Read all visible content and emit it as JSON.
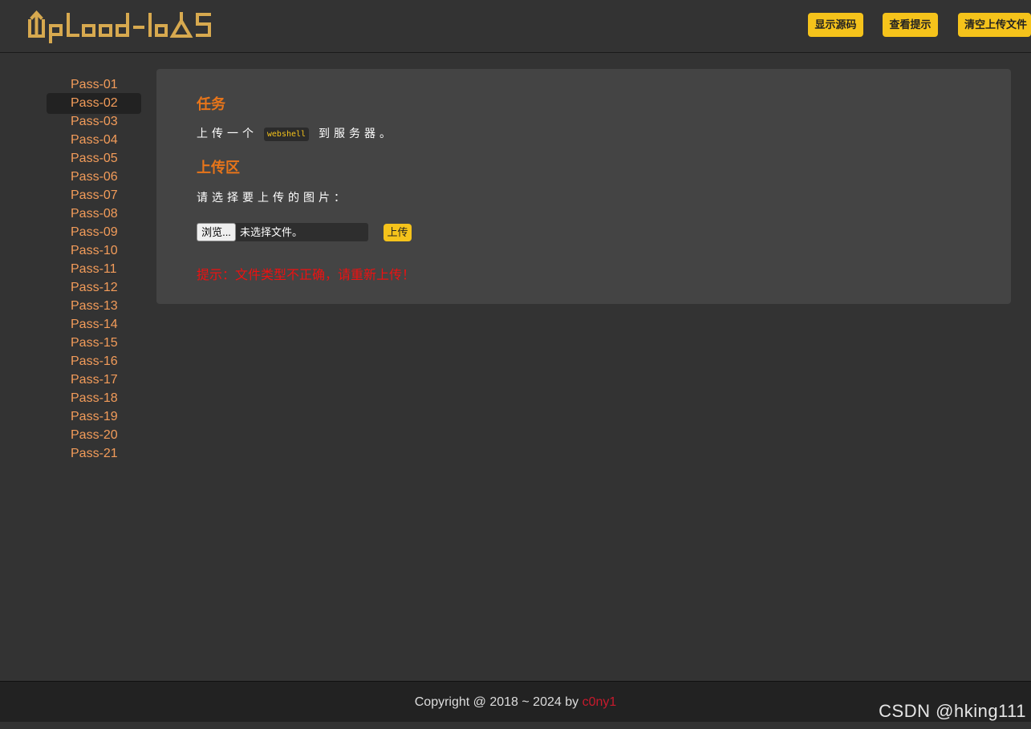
{
  "header": {
    "logo_text": "UpLoad-labS",
    "logo_color": "#d7a94f",
    "buttons": {
      "show_source": "显示源码",
      "view_hint": "查看提示",
      "clear_uploads": "清空上传文件"
    }
  },
  "sidebar": {
    "active_index": 1,
    "items": [
      {
        "label": "Pass-01"
      },
      {
        "label": "Pass-02"
      },
      {
        "label": "Pass-03"
      },
      {
        "label": "Pass-04"
      },
      {
        "label": "Pass-05"
      },
      {
        "label": "Pass-06"
      },
      {
        "label": "Pass-07"
      },
      {
        "label": "Pass-08"
      },
      {
        "label": "Pass-09"
      },
      {
        "label": "Pass-10"
      },
      {
        "label": "Pass-11"
      },
      {
        "label": "Pass-12"
      },
      {
        "label": "Pass-13"
      },
      {
        "label": "Pass-14"
      },
      {
        "label": "Pass-15"
      },
      {
        "label": "Pass-16"
      },
      {
        "label": "Pass-17"
      },
      {
        "label": "Pass-18"
      },
      {
        "label": "Pass-19"
      },
      {
        "label": "Pass-20"
      },
      {
        "label": "Pass-21"
      }
    ]
  },
  "main": {
    "task_title": "任务",
    "task_prefix": "上传一个",
    "task_code": "webshell",
    "task_suffix": "到服务器。",
    "upload_title": "上传区",
    "choose_label": "请选择要上传的图片：",
    "browse_label": "浏览...",
    "file_status": "未选择文件。",
    "upload_button": "上传",
    "error_message": "提示：文件类型不正确，请重新上传！"
  },
  "footer": {
    "copyright": "Copyright @ 2018 ~ 2024 by ",
    "author": "c0ny1"
  },
  "watermark": "CSDN @hking111",
  "colors": {
    "accent": "#f5c31b",
    "heading": "#e8751a",
    "link": "#f39c5a",
    "error": "#ee1111"
  }
}
